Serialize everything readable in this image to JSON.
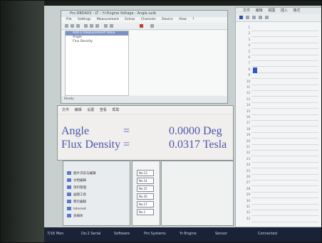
{
  "main_window": {
    "title": "Pro DBDA03 - LT - Yr-Engine Voltage - Angle.uxlb",
    "menu": [
      "File",
      "Settings",
      "Measurement",
      "Extras",
      "Channels",
      "Device",
      "View",
      "?"
    ],
    "list_items": [
      "Add a measurement Value",
      "Angle",
      "Flux Density"
    ],
    "status": "Ready"
  },
  "display_window": {
    "menu": [
      "文件",
      "编辑",
      "设置",
      "查看",
      "帮助"
    ],
    "rows": [
      {
        "label": "Angle",
        "sep": "=",
        "value": "0.0000 Deg"
      },
      {
        "label": "Flux Density",
        "sep": "=",
        "value": "0.0317 Tesla"
      }
    ]
  },
  "tree_panel": {
    "items": [
      "图片浏览与编辑",
      "文档编辑",
      "资料管理",
      "画图工具",
      "网页编辑",
      "Internet",
      "多媒体"
    ]
  },
  "number_list": {
    "items": [
      "No.13",
      "No.14",
      "No.15",
      "No.16",
      "No.17",
      "No.1"
    ]
  },
  "spreadsheet": {
    "menu": [
      "文件",
      "编辑",
      "视图",
      "插入",
      "格式"
    ],
    "row_labels": [
      "1",
      "2",
      "3",
      "4",
      "5",
      "6",
      "7",
      "8",
      "9",
      "10",
      "11",
      "12",
      "13",
      "14",
      "15",
      "16",
      "17",
      "18",
      "19",
      "20",
      "21",
      "22",
      "23",
      "24",
      "25",
      "26",
      "27",
      "28",
      "29",
      "30",
      "31",
      "32",
      "33"
    ]
  },
  "taskbar": {
    "items": [
      "7/16 Mon",
      "Do:2 Serial",
      "Software",
      "Pro Systems",
      "Yr-Engine",
      "Sensor",
      "Connected"
    ]
  }
}
